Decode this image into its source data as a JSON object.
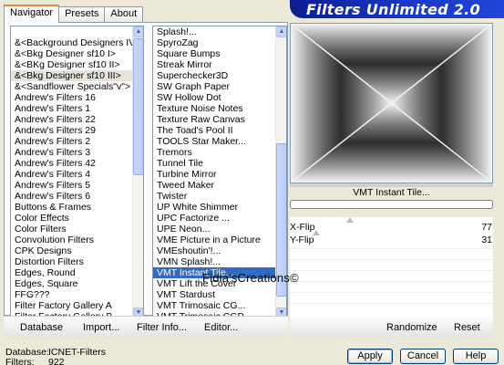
{
  "tabs": [
    "Navigator",
    "Presets",
    "About"
  ],
  "banner_title": "Filters Unlimited 2.0",
  "categories": [
    "&<Background Designers IV>",
    "&<Bkg Designer sf10 I>",
    "&<BKg Designer sf10 II>",
    "&<Bkg Designer sf10 III>",
    "&<Sandflower Specials\"v\">",
    "Andrew's Filters 16",
    "Andrew's Filters 1",
    "Andrew's Filters 22",
    "Andrew's Filters 29",
    "Andrew's Filters 2",
    "Andrew's Filters 3",
    "Andrew's Filters 42",
    "Andrew's Filters 4",
    "Andrew's Filters 5",
    "Andrew's Filters 6",
    "Buttons & Frames",
    "Color Effects",
    "Color Filters",
    "Convolution Filters",
    "CPK Designs",
    "Distortion Filters",
    "Edges, Round",
    "Edges, Square",
    "FFG???",
    "Filter Factory Gallery A",
    "Filter Factory Gallery B"
  ],
  "selected_category": "&<Bkg Designer sf10 III>",
  "filters": [
    "Splash!...",
    "SpyroZag",
    "Square Bumps",
    "Streak Mirror",
    "Superchecker3D",
    "SW Graph Paper",
    "SW Hollow Dot",
    "Texture Noise Notes",
    "Texture Raw Canvas",
    "The Toad's Pool II",
    "TOOLS Star Maker...",
    "Tremors",
    "Tunnel Tile",
    "Turbine Mirror",
    "Tweed Maker",
    "Twister",
    "UP White Shimmer",
    "UPC Factorize ...",
    "UPE Neon...",
    "VME Picture in a Picture",
    "VMEshoutin'!...",
    "VMN Splash!...",
    "VMT Instant Tile...",
    "VMT Lift the Cover",
    "VMT Stardust",
    "VMT Trimosaic CG...",
    "VMT Trimosaic CGD..."
  ],
  "selected_filter": "VMT Instant Tile...",
  "preview_label": "VMT Instant Tile...",
  "params": [
    {
      "label": "X-Flip",
      "value": "77"
    },
    {
      "label": "Y-Flip",
      "value": "31"
    }
  ],
  "watermark": "Fidia'sCreations©",
  "bottom_buttons": {
    "database": "Database",
    "import": "Import...",
    "filter_info": "Filter Info...",
    "editor": "Editor...",
    "randomize": "Randomize",
    "reset": "Reset"
  },
  "footer": {
    "database_label": "Database:",
    "database_value": "ICNET-Filters",
    "filters_label": "Filters:",
    "filters_value": "922"
  },
  "dialog_buttons": {
    "apply": "Apply",
    "cancel": "Cancel",
    "help": "Help"
  },
  "colors": {
    "accent_blue": "#316ac5",
    "banner": "#1838c8",
    "tab_highlight": "#e68b2c"
  }
}
